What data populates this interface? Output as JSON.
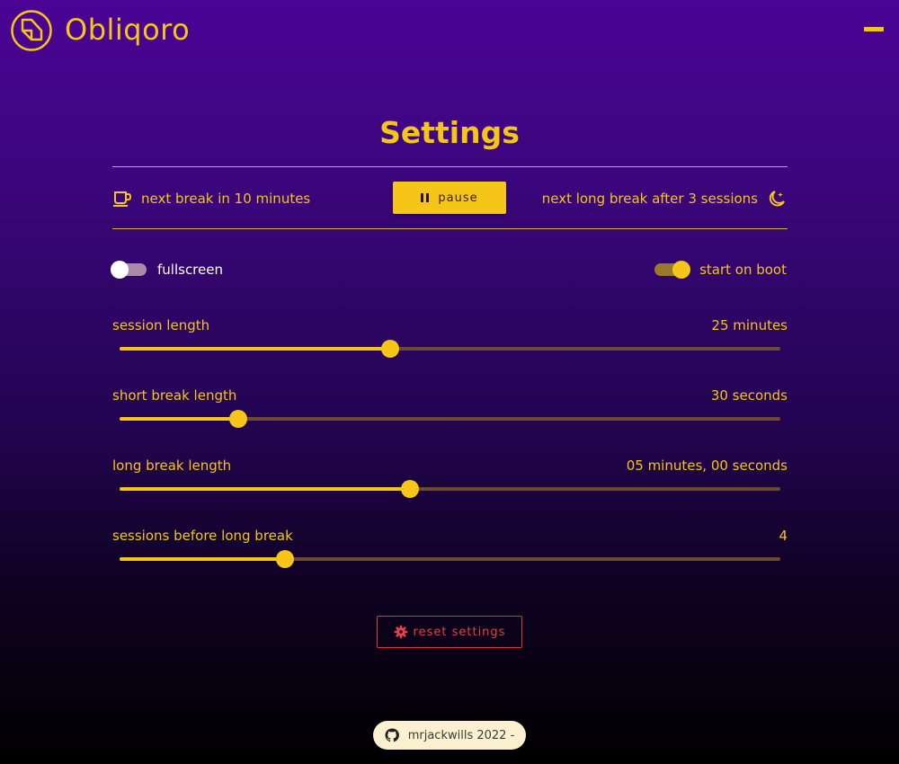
{
  "app": {
    "brand": "Obliqoro"
  },
  "page": {
    "title": "Settings"
  },
  "status": {
    "next_break": "next break in 10 minutes",
    "pause_label": "pause",
    "next_long_break": "next long break after 3 sessions"
  },
  "toggles": {
    "fullscreen": {
      "label": "fullscreen",
      "on": false
    },
    "start_on_boot": {
      "label": "start on boot",
      "on": true
    }
  },
  "sliders": [
    {
      "label": "session length",
      "value": "25 minutes",
      "fraction": 0.41
    },
    {
      "label": "short break length",
      "value": "30 seconds",
      "fraction": 0.18
    },
    {
      "label": "long break length",
      "value": "05 minutes, 00 seconds",
      "fraction": 0.44
    },
    {
      "label": "sessions before long break",
      "value": "4",
      "fraction": 0.25
    }
  ],
  "reset": {
    "label": "reset settings"
  },
  "footer": {
    "text": "mrjackwills 2022 -"
  },
  "colors": {
    "accent": "#f5c518",
    "danger": "#e0434a",
    "bg_top": "#4b0496",
    "bg_bottom": "#000000"
  },
  "icons": {
    "logo": "obliqoro-logo-icon",
    "menu": "hamburger-menu-icon",
    "coffee": "coffee-cup-icon",
    "moon": "moon-stars-icon",
    "pause": "pause-icon",
    "reset": "gear-icon",
    "github": "github-icon"
  }
}
